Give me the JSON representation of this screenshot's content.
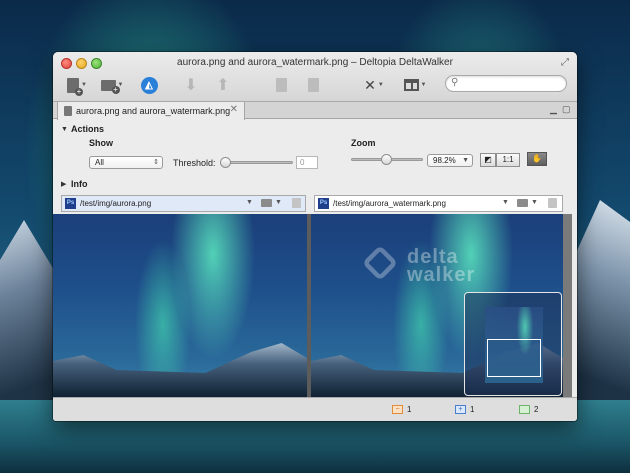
{
  "window": {
    "title": "aurora.png and aurora_watermark.png – Deltopia DeltaWalker"
  },
  "toolbar": {
    "search_placeholder": "",
    "icons": [
      "new-document-icon",
      "new-folder-icon",
      "deltawalker-icon",
      "arrow-down-icon",
      "arrow-up-icon",
      "copy-left-icon",
      "copy-right-icon",
      "tools-icon",
      "layout-icon"
    ]
  },
  "tab": {
    "label": "aurora.png and aurora_watermark.png"
  },
  "actions": {
    "header": "Actions",
    "show_label": "Show",
    "show_value": "All",
    "threshold_label": "Threshold:",
    "threshold_value": "0",
    "zoom_label": "Zoom",
    "zoom_value": "98.2%",
    "zoom_fit_label": "",
    "zoom_actual_label": "1:1"
  },
  "info": {
    "header": "Info"
  },
  "panes": {
    "left_path": "/test/img/aurora.png",
    "right_path": "/test/img/aurora_watermark.png",
    "file_type_badge": "Ps",
    "watermark_text_line1": "delta",
    "watermark_text_line2": "walker"
  },
  "status": {
    "changed_count": "1",
    "added_count": "1",
    "matched_count": "2",
    "changed_color": "#f0a35a",
    "added_color": "#5b8fd8",
    "matched_color": "#8fcf8a"
  }
}
